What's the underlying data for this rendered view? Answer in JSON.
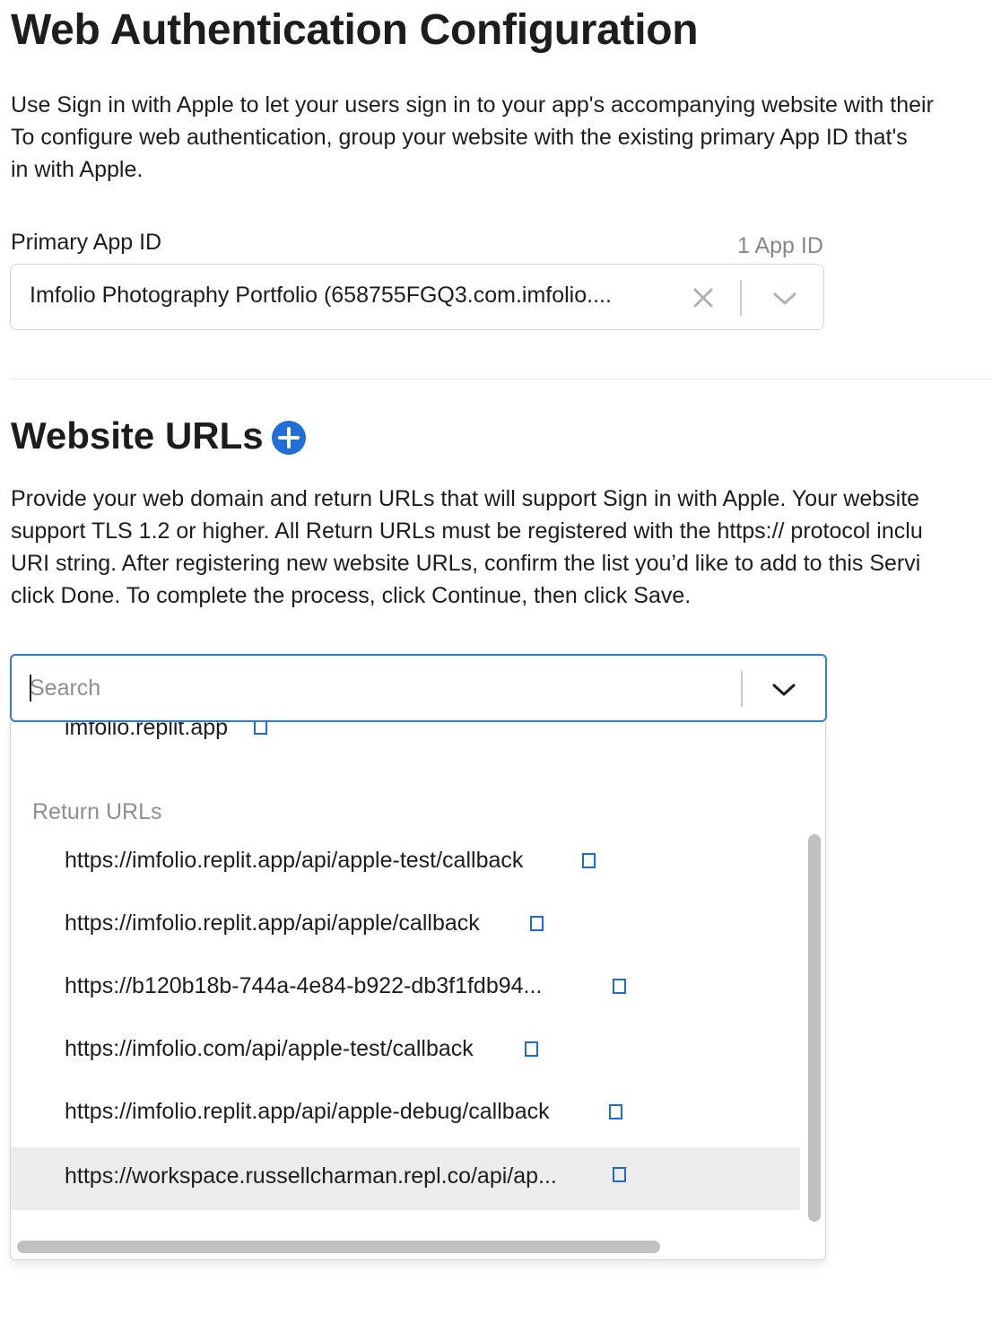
{
  "page": {
    "title": "Web Authentication Configuration",
    "intro_lines": [
      "Use Sign in with Apple to let your users sign in to your app's accompanying website with their",
      "To configure web authentication, group your website with the existing primary App ID that's",
      "in with Apple."
    ]
  },
  "primary_app_id": {
    "label": "Primary App ID",
    "count": "1 App ID",
    "selected_value": "Imfolio Photography Portfolio (658755FGQ3.com.imfolio....",
    "clear_icon": "close-icon",
    "toggle_icon": "chevron-down-icon"
  },
  "website_urls": {
    "heading": "Website URLs",
    "add_icon": "plus-circle-icon",
    "description_lines": [
      "Provide your web domain and return URLs that will support Sign in with Apple. Your website",
      "support TLS 1.2 or higher. All Return URLs must be registered with the https:// protocol inclu",
      "URI string. After registering new website URLs, confirm the list you’d like to add to this Servi",
      "click Done. To complete the process, click Continue, then click Save."
    ],
    "search": {
      "placeholder": "Search",
      "value": ""
    },
    "dropdown": {
      "domain_item": "imfolio.replit.app",
      "group_label": "Return URLs",
      "return_urls": [
        "https://imfolio.replit.app/api/apple-test/callback",
        "https://imfolio.replit.app/api/apple/callback",
        "https://b120b18b-744a-4e84-b922-db3f1fdb94...",
        "https://imfolio.com/api/apple-test/callback",
        "https://imfolio.replit.app/api/apple-debug/callback",
        "https://workspace.russellcharman.repl.co/api/ap..."
      ],
      "highlighted_index": 5
    }
  },
  "colors": {
    "accent": "#2d7de0",
    "link_icon": "#1b6bd1",
    "muted_text": "#8e8e93",
    "highlight_row": "#ececec"
  }
}
